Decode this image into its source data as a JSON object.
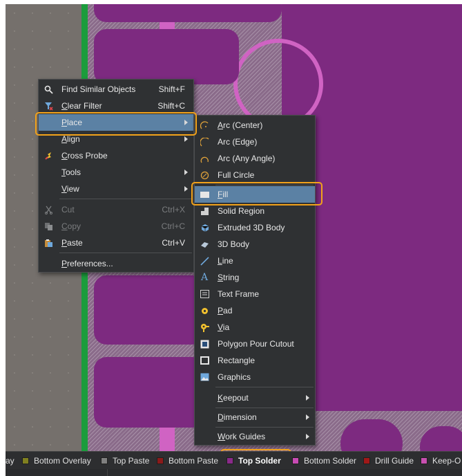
{
  "context_menu": {
    "items": [
      {
        "label": "Find Similar Objects",
        "shortcut": "Shift+F",
        "icon": "find-similar-icon"
      },
      {
        "label": "Clear Filter",
        "shortcut": "Shift+C",
        "icon": "clear-filter-icon"
      },
      {
        "label": "Place",
        "submenu": true,
        "highlighted": true
      },
      {
        "label": "Align",
        "submenu": true
      },
      {
        "label": "Cross Probe",
        "icon": "cross-probe-icon"
      },
      {
        "label": "Tools",
        "submenu": true
      },
      {
        "label": "View",
        "submenu": true
      },
      {
        "label": "Cut",
        "shortcut": "Ctrl+X",
        "disabled": true,
        "icon": "cut-icon"
      },
      {
        "label": "Copy",
        "shortcut": "Ctrl+C",
        "disabled": true,
        "icon": "copy-icon"
      },
      {
        "label": "Paste",
        "shortcut": "Ctrl+V",
        "icon": "paste-icon"
      },
      {
        "label": "Preferences..."
      }
    ]
  },
  "place_submenu": {
    "items": [
      {
        "label": "Arc (Center)",
        "icon": "arc-center-icon"
      },
      {
        "label": "Arc (Edge)",
        "icon": "arc-edge-icon"
      },
      {
        "label": "Arc (Any Angle)",
        "icon": "arc-any-angle-icon"
      },
      {
        "label": "Full Circle",
        "icon": "full-circle-icon"
      },
      {
        "label": "Fill",
        "icon": "fill-icon",
        "highlighted": true
      },
      {
        "label": "Solid Region",
        "icon": "solid-region-icon"
      },
      {
        "label": "Extruded 3D Body",
        "icon": "extruded-3d-body-icon"
      },
      {
        "label": "3D Body",
        "icon": "3d-body-icon"
      },
      {
        "label": "Line",
        "icon": "line-icon"
      },
      {
        "label": "String",
        "icon": "string-icon"
      },
      {
        "label": "Text Frame",
        "icon": "text-frame-icon"
      },
      {
        "label": "Pad",
        "icon": "pad-icon"
      },
      {
        "label": "Via",
        "icon": "via-icon"
      },
      {
        "label": "Polygon Pour Cutout",
        "icon": "polygon-pour-cutout-icon"
      },
      {
        "label": "Rectangle",
        "icon": "rectangle-icon"
      },
      {
        "label": "Graphics",
        "icon": "graphics-icon"
      },
      {
        "label": "Keepout",
        "submenu": true
      },
      {
        "label": "Dimension",
        "submenu": true
      },
      {
        "label": "Work Guides",
        "submenu": true
      }
    ]
  },
  "layer_tabs": [
    {
      "label": "ay",
      "color": ""
    },
    {
      "label": "Bottom Overlay",
      "color": "#808020"
    },
    {
      "label": "Top Paste",
      "color": "#808080"
    },
    {
      "label": "Bottom Paste",
      "color": "#8b1a1a"
    },
    {
      "label": "Top Solder",
      "color": "#8a2a8a",
      "active": true
    },
    {
      "label": "Bottom Solder",
      "color": "#c84bb4"
    },
    {
      "label": "Drill Guide",
      "color": "#a01818"
    },
    {
      "label": "Keep-O",
      "color": "#c850b0"
    }
  ],
  "colors": {
    "accent_callout": "#f2a21a",
    "menu_bg": "#2f3133",
    "highlight": "#5b81a4",
    "board_purple": "#7d2a80"
  }
}
